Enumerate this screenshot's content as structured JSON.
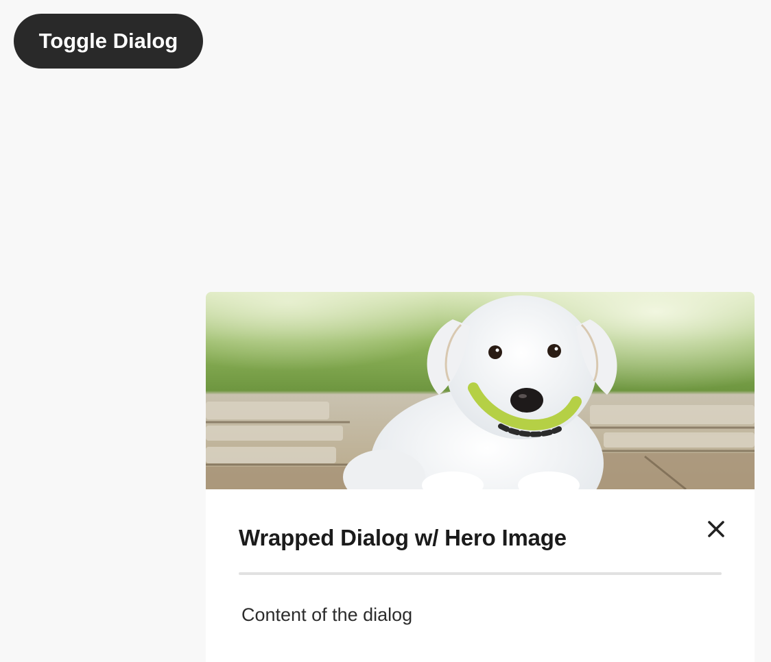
{
  "toggle_button": {
    "label": "Toggle Dialog"
  },
  "dialog": {
    "hero_image": "white puppy with green collar lying on stone patio",
    "title": "Wrapped Dialog w/ Hero Image",
    "close_icon": "close-icon",
    "content": "Content of the dialog"
  },
  "colors": {
    "page_background": "#f8f8f8",
    "button_background": "#292929",
    "button_text": "#ffffff",
    "dialog_background": "#ffffff",
    "title_text": "#1b1b1b",
    "divider": "#e1e1e1"
  }
}
